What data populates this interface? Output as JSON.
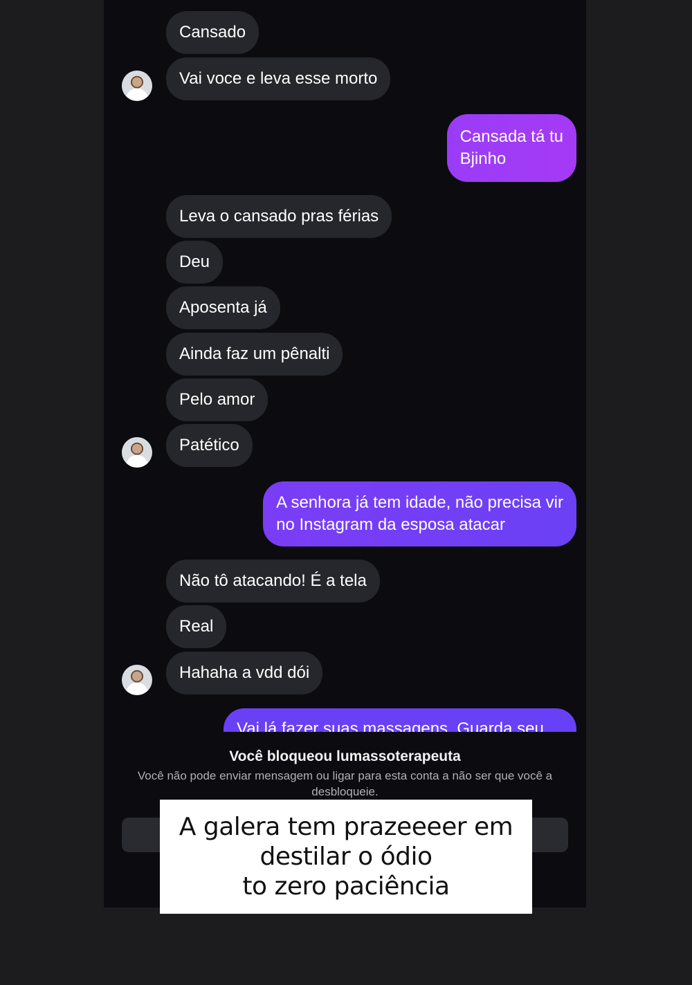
{
  "thread": {
    "messages": [
      {
        "side": "in",
        "text": "Cansado"
      },
      {
        "side": "in",
        "text": "Vai voce e leva esse morto"
      },
      {
        "side": "out",
        "lines": [
          "Cansada tá tu",
          "Bjinho"
        ]
      },
      {
        "side": "in",
        "text": "Leva o cansado pras férias"
      },
      {
        "side": "in",
        "text": "Deu"
      },
      {
        "side": "in",
        "text": "Aposenta já"
      },
      {
        "side": "in",
        "text": "Ainda faz um pênalti"
      },
      {
        "side": "in",
        "text": "Pelo amor"
      },
      {
        "side": "in",
        "text": "Patético"
      },
      {
        "side": "out",
        "lines": [
          "A senhora já tem idade, não precisa vir",
          "no Instagram da esposa atacar"
        ]
      },
      {
        "side": "in",
        "text": "Não tô atacando! É a tela"
      },
      {
        "side": "in",
        "text": "Real"
      },
      {
        "side": "in",
        "text": "Hahaha a vdd dói"
      },
      {
        "side": "out",
        "lines": [
          "Vai lá fazer suas massagens. Guarda seu"
        ]
      }
    ]
  },
  "blocked_notice": {
    "title": "Você bloqueou lumassoterapeuta",
    "description": "Você não pode enviar mensagem ou ligar para esta conta a não ser que você a desbloqueie."
  },
  "caption": {
    "lines": [
      "A galera tem prazeeeer em",
      "destilar o ódio",
      "to zero paciência"
    ]
  },
  "colors": {
    "incoming_bubble": "#26272c",
    "outgoing_gradient_start": "#a238f5",
    "outgoing_gradient_end": "#6a3ff5",
    "background": "#0b0b10"
  }
}
